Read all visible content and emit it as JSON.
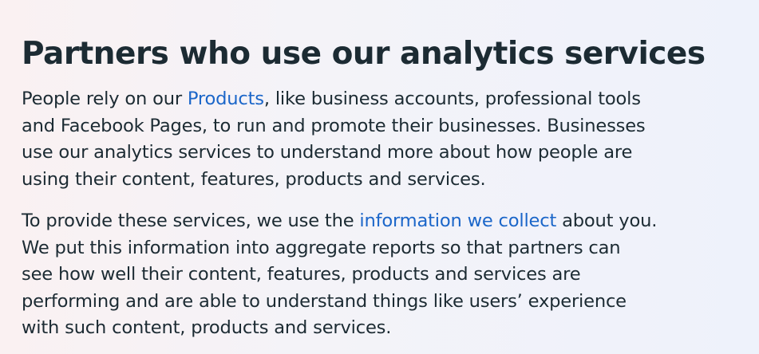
{
  "section": {
    "heading": "Partners who use our analytics services",
    "paragraph1": {
      "line1_before_link": "People rely on our ",
      "line1_link": "Products",
      "line1_after_link": ", like business accounts, professional tools",
      "line2": "and Facebook Pages, to run and promote their businesses. Businesses",
      "line3": "use our analytics services to understand more about how people are",
      "line4": "using their content, features, products and services."
    },
    "paragraph2": {
      "line1_before_link": "To provide these services, we use the ",
      "line1_link": "information we collect",
      "line1_after_link": " about you.",
      "line2": "We put this information into aggregate reports so that partners can",
      "line3": "see how well their content, features, products and services are",
      "line4": "performing and are able to understand things like users’ experience",
      "line5": "with such content, products and services."
    }
  },
  "colors": {
    "text": "#1c2b33",
    "link": "#1b66c9"
  }
}
